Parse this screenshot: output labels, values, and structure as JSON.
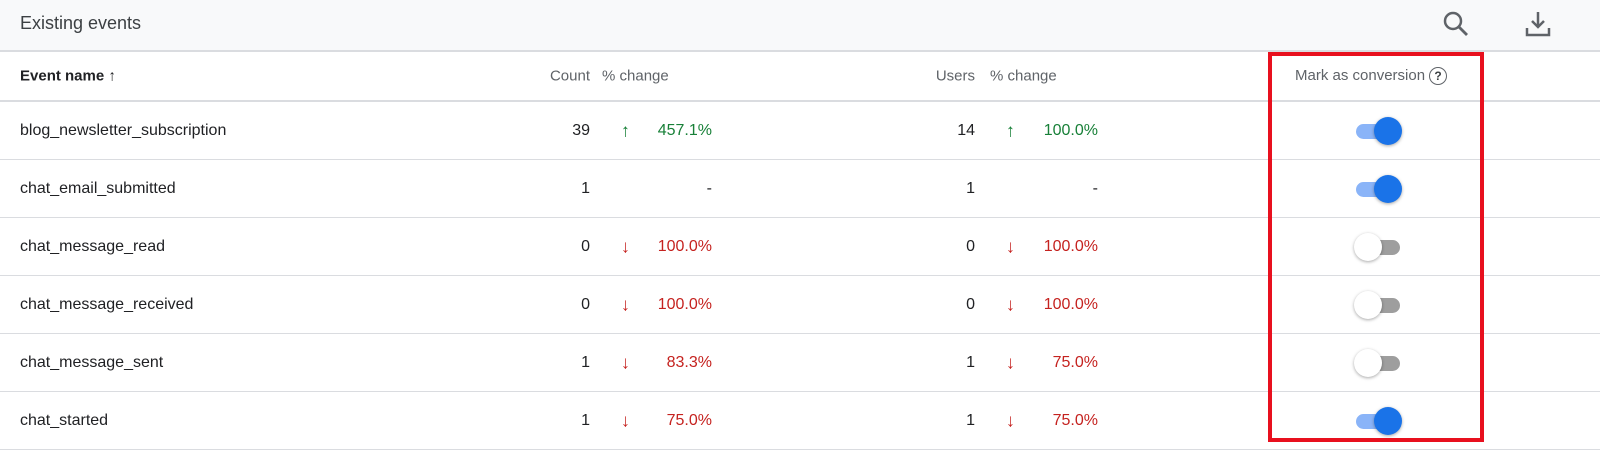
{
  "header": {
    "title": "Existing events",
    "search_icon": "search-icon",
    "download_icon": "download-icon"
  },
  "columns": {
    "event_name": "Event name ↑",
    "count": "Count",
    "count_change": "% change",
    "users": "Users",
    "users_change": "% change",
    "mark_conversion": "Mark as conversion",
    "help": "?"
  },
  "rows": [
    {
      "name": "blog_newsletter_subscription",
      "count": "39",
      "count_dir": "up",
      "count_change": "457.1%",
      "users": "14",
      "users_dir": "up",
      "users_change": "100.0%",
      "conversion": true
    },
    {
      "name": "chat_email_submitted",
      "count": "1",
      "count_dir": "none",
      "count_change": "-",
      "users": "1",
      "users_dir": "none",
      "users_change": "-",
      "conversion": true
    },
    {
      "name": "chat_message_read",
      "count": "0",
      "count_dir": "down",
      "count_change": "100.0%",
      "users": "0",
      "users_dir": "down",
      "users_change": "100.0%",
      "conversion": false
    },
    {
      "name": "chat_message_received",
      "count": "0",
      "count_dir": "down",
      "count_change": "100.0%",
      "users": "0",
      "users_dir": "down",
      "users_change": "100.0%",
      "conversion": false
    },
    {
      "name": "chat_message_sent",
      "count": "1",
      "count_dir": "down",
      "count_change": "83.3%",
      "users": "1",
      "users_dir": "down",
      "users_change": "75.0%",
      "conversion": false
    },
    {
      "name": "chat_started",
      "count": "1",
      "count_dir": "down",
      "count_change": "75.0%",
      "users": "1",
      "users_dir": "down",
      "users_change": "75.0%",
      "conversion": true
    }
  ],
  "colors": {
    "up": "#188038",
    "down": "#c5221f",
    "accent": "#1a73e8",
    "highlight": "#e8101e"
  }
}
